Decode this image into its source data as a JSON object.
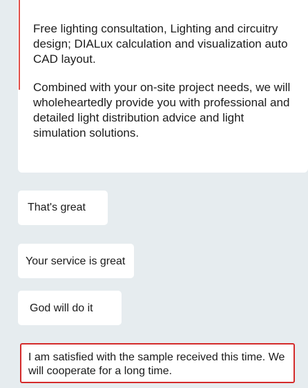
{
  "service_card": {
    "paragraph_1": "Free lighting consultation, Lighting and circuitry design; DIALux calculation and visualization auto CAD layout.",
    "paragraph_2": "Combined with your on-site project needs, we will wholeheartedly provide you with professional and detailed light distribution advice and light simulation solutions."
  },
  "messages": [
    {
      "text": "That's great"
    },
    {
      "text": "Your service is great"
    },
    {
      "text": "God will do it"
    },
    {
      "text": "I am satisfied with the sample received this time. We will cooperate for a long time.",
      "highlighted": true
    }
  ],
  "colors": {
    "background": "#e6ecef",
    "bubble": "#ffffff",
    "highlight_border": "#d42a2a",
    "accent_line": "#e0504a"
  }
}
